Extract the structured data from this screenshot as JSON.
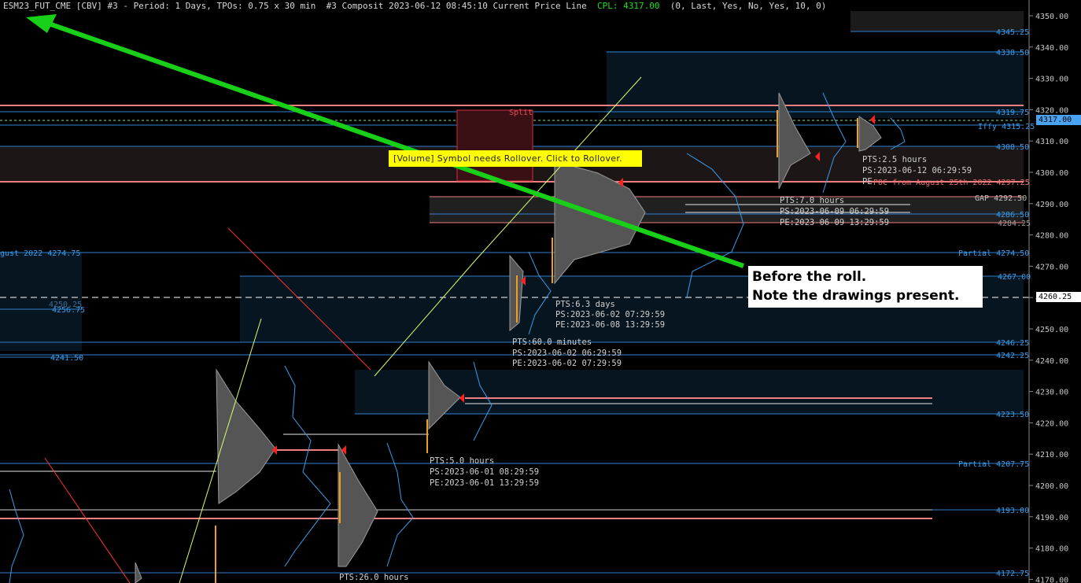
{
  "header": {
    "text": "ESM23_FUT_CME [CBV] #3 - Period: 1 Days, TPOs: 0.75 x 30 min  #3 Composit 2023-06-12 08:45:10 Current Price Line  ",
    "cpl_label": "CPL: 4317.00",
    "params": "  (0, Last, Yes, No, Yes, 10, 0)"
  },
  "price_axis": {
    "ticks": [
      "4350.00",
      "4340.00",
      "4330.00",
      "4320.00",
      "4310.00",
      "4300.00",
      "4290.00",
      "4280.00",
      "4270.00",
      "4260.00",
      "4250.00",
      "4240.00",
      "4230.00",
      "4220.00",
      "4210.00",
      "4200.00",
      "4190.00",
      "4180.00",
      "4170.00"
    ],
    "current_price": "4317.00",
    "crosshair_price": "4260.25"
  },
  "levels": {
    "l434525": "4345.25",
    "l433850": "4338.50",
    "l431975": "4319.75",
    "iffy": "Iffy  4315.25",
    "l430850": "4308.50",
    "poc_aug": "POC from August 25th 2022  4297.25",
    "gap": "GAP  4292.50",
    "l428650": "4286.50",
    "l428425": "4284.25",
    "partial_top": "Partial  4274.50",
    "left_aug": "gust 2022  4274.75",
    "l426700": "4267.00",
    "l425675": "4256.75",
    "l425025": "4250.25",
    "l424625": "4246.25",
    "l424225": "4242.25",
    "l424150": "4241.50",
    "l422350": "4223.50",
    "partial_bottom": "Partial  4207.75",
    "l419300": "4193.00",
    "l417275": "4172.75"
  },
  "split_label": "Split",
  "rollover_text": "[Volume] Symbol needs Rollover. Click to Rollover.",
  "note": {
    "line1": "Before the roll.",
    "line2": "Note the drawings present."
  },
  "profiles": {
    "p1": [
      "PTS:6.3 days",
      "PS:2023-06-02  07:29:59",
      "PE:2023-06-08  13:29:59"
    ],
    "p2": [
      "PTS:60.0 minutes",
      "PS:2023-06-02  06:29:59",
      "PE:2023-06-02  07:29:59"
    ],
    "p3": [
      "PTS:7.0 hours",
      "PS:2023-06-09  06:29:59",
      "PE:2023-06-09  13:29:59"
    ],
    "p4": [
      "PTS:2.5 hours",
      "PS:2023-06-12  06:29:59",
      "PE"
    ],
    "p5": [
      "PTS:5.0 hours",
      "PS:2023-06-01  08:29:59",
      "PE:2023-06-01  13:29:59"
    ],
    "p6": [
      "PTS:26.0 hours"
    ]
  },
  "colors": {
    "level_line": "#2f7fd0",
    "poc_line": "#f08080",
    "arrow_green": "#19d019",
    "current_price_bg": "#4aa3f0"
  }
}
